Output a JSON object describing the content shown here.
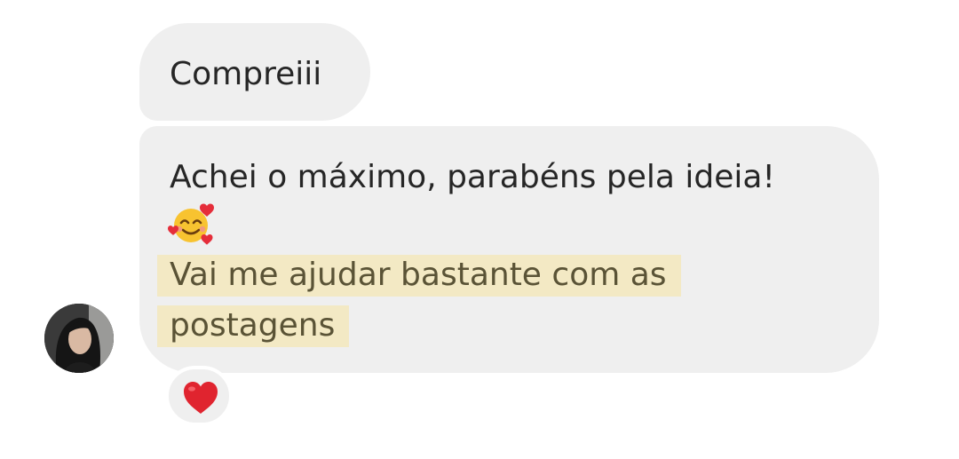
{
  "messages": [
    {
      "lines": [
        "Compreiii"
      ]
    },
    {
      "line_1": "Achei o máximo, parabéns pela ideia!",
      "emoji": "smiling-face-with-hearts-icon",
      "highlighted_line_1": "Vai me ajudar bastante com as",
      "highlighted_line_2": "postagens"
    }
  ],
  "reaction": {
    "emoji": "red-heart-icon"
  },
  "colors": {
    "bubble": "#efefef",
    "highlight": "#f3e9c4",
    "text": "#262626",
    "heart": "#e0242f"
  }
}
